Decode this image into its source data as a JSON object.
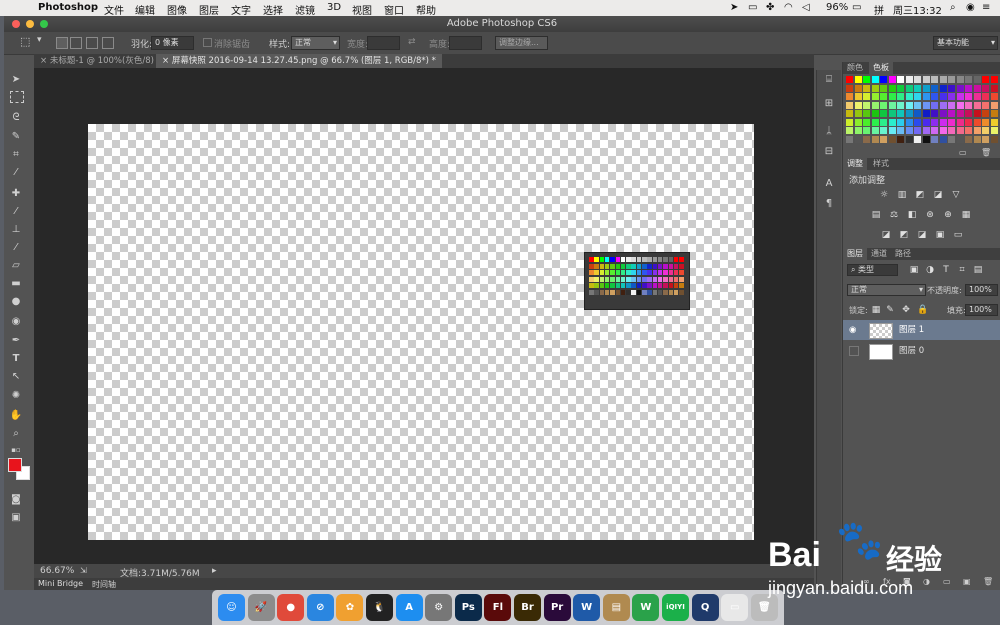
{
  "menubar": {
    "app_name": "Photoshop",
    "items": [
      "文件",
      "编辑",
      "图像",
      "图层",
      "文字",
      "选择",
      "滤镜",
      "3D",
      "视图",
      "窗口",
      "帮助"
    ],
    "battery": "96%",
    "clock": "周三13:32"
  },
  "window": {
    "title": "Adobe Photoshop CS6",
    "workspace": "基本功能"
  },
  "options": {
    "feather_label": "羽化:",
    "feather_value": "0 像素",
    "antialias_label": "消除锯齿",
    "style_label": "样式:",
    "style_value": "正常",
    "width_label": "宽度:",
    "height_label": "高度:",
    "refine_edge": "调整边缘..."
  },
  "tabs": [
    {
      "label": "未标题-1 @ 100%(灰色/8)"
    },
    {
      "label": "屏幕快照 2016-09-14 13.27.45.png @ 66.7% (图层 1, RGB/8*) *"
    }
  ],
  "status": {
    "zoom": "66.67%",
    "doc_info": "文档:3.71M/5.76M"
  },
  "bottom_tabs": [
    "Mini Bridge",
    "时间轴"
  ],
  "panels": {
    "swatch_tabs": [
      "颜色",
      "色板"
    ],
    "adjust_tabs": [
      "调整",
      "样式"
    ],
    "adjust_title": "添加调整",
    "layer_tabs": [
      "图层",
      "通道",
      "路径"
    ],
    "filter_kind": "类型",
    "blend_mode": "正常",
    "opacity_label": "不透明度:",
    "opacity_value": "100%",
    "lock_label": "锁定:",
    "fill_label": "填充:",
    "fill_value": "100%",
    "layers": [
      {
        "name": "图层 1",
        "selected": true
      },
      {
        "name": "图层 0",
        "selected": false
      }
    ]
  },
  "colors": {
    "foreground": "#e8141c",
    "background": "#ffffff"
  },
  "dock_apps": [
    {
      "icon": "finder-icon",
      "abbr": "☺",
      "color": "#2c8cf0"
    },
    {
      "icon": "launchpad-icon",
      "abbr": "🚀",
      "color": "#8c8c8c"
    },
    {
      "icon": "chrome-icon",
      "abbr": "●",
      "color": "#e04a3a"
    },
    {
      "icon": "safari-icon",
      "abbr": "⊘",
      "color": "#2a86e0"
    },
    {
      "icon": "photos-icon",
      "abbr": "✿",
      "color": "#f0a030"
    },
    {
      "icon": "qq-icon",
      "abbr": "🐧",
      "color": "#222"
    },
    {
      "icon": "app-store-icon",
      "abbr": "A",
      "color": "#1d8ef0"
    },
    {
      "icon": "system-preferences-icon",
      "abbr": "⚙",
      "color": "#777"
    },
    {
      "icon": "photoshop-icon",
      "abbr": "Ps",
      "color": "#0b2a4a"
    },
    {
      "icon": "flash-icon",
      "abbr": "Fl",
      "color": "#5a0a0a"
    },
    {
      "icon": "bridge-icon",
      "abbr": "Br",
      "color": "#3a2a05"
    },
    {
      "icon": "premiere-icon",
      "abbr": "Pr",
      "color": "#2a0a3a"
    },
    {
      "icon": "word-icon",
      "abbr": "W",
      "color": "#1f5aa8"
    },
    {
      "icon": "archive-utility-icon",
      "abbr": "▤",
      "color": "#b08a50"
    },
    {
      "icon": "wechat-icon",
      "abbr": "W",
      "color": "#2aa24a"
    },
    {
      "icon": "iqiyi-icon",
      "abbr": "iQIYI",
      "color": "#1bb04a"
    },
    {
      "icon": "quicktime-icon",
      "abbr": "Q",
      "color": "#1f3a6a"
    },
    {
      "icon": "preview-icon",
      "abbr": "▭",
      "color": "#e8e8e8"
    },
    {
      "icon": "trash-icon",
      "abbr": "🗑",
      "color": "#bcbcbc"
    }
  ],
  "watermark": {
    "brand": "Bai",
    "cn": "经验",
    "url": "jingyan.baidu.com"
  }
}
